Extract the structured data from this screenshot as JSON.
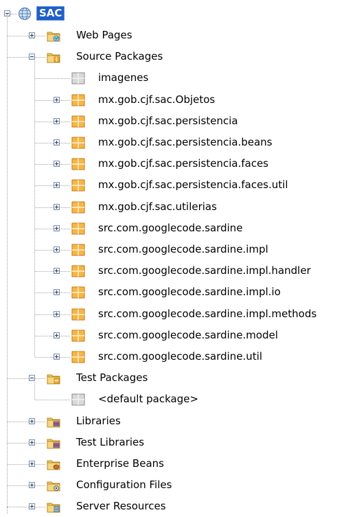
{
  "tree": {
    "root": {
      "label": "SAC",
      "icon": "globe-project-icon"
    },
    "nodes": [
      {
        "label": "Web Pages",
        "icon": "web-folder-icon",
        "level": 1,
        "toggle": "plus"
      },
      {
        "label": "Source Packages",
        "icon": "source-folder-icon",
        "level": 1,
        "toggle": "minus"
      },
      {
        "label": "imagenes",
        "icon": "empty-package-icon",
        "level": 2,
        "toggle": "none"
      },
      {
        "label": "mx.gob.cjf.sac.Objetos",
        "icon": "package-icon",
        "level": 2,
        "toggle": "plus"
      },
      {
        "label": "mx.gob.cjf.sac.persistencia",
        "icon": "package-icon",
        "level": 2,
        "toggle": "plus"
      },
      {
        "label": "mx.gob.cjf.sac.persistencia.beans",
        "icon": "package-icon",
        "level": 2,
        "toggle": "plus"
      },
      {
        "label": "mx.gob.cjf.sac.persistencia.faces",
        "icon": "package-icon",
        "level": 2,
        "toggle": "plus"
      },
      {
        "label": "mx.gob.cjf.sac.persistencia.faces.util",
        "icon": "package-icon",
        "level": 2,
        "toggle": "plus"
      },
      {
        "label": "mx.gob.cjf.sac.utilerias",
        "icon": "package-icon",
        "level": 2,
        "toggle": "plus"
      },
      {
        "label": "src.com.googlecode.sardine",
        "icon": "package-icon",
        "level": 2,
        "toggle": "plus"
      },
      {
        "label": "src.com.googlecode.sardine.impl",
        "icon": "package-icon",
        "level": 2,
        "toggle": "plus"
      },
      {
        "label": "src.com.googlecode.sardine.impl.handler",
        "icon": "package-icon",
        "level": 2,
        "toggle": "plus"
      },
      {
        "label": "src.com.googlecode.sardine.impl.io",
        "icon": "package-icon",
        "level": 2,
        "toggle": "plus"
      },
      {
        "label": "src.com.googlecode.sardine.impl.methods",
        "icon": "package-icon",
        "level": 2,
        "toggle": "plus"
      },
      {
        "label": "src.com.googlecode.sardine.model",
        "icon": "package-icon",
        "level": 2,
        "toggle": "plus"
      },
      {
        "label": "src.com.googlecode.sardine.util",
        "icon": "package-icon",
        "level": 2,
        "toggle": "plus"
      },
      {
        "label": "Test Packages",
        "icon": "test-folder-icon",
        "level": 1,
        "toggle": "minus"
      },
      {
        "label": "<default package>",
        "icon": "empty-package-icon",
        "level": 2,
        "toggle": "none"
      },
      {
        "label": "Libraries",
        "icon": "library-folder-icon",
        "level": 1,
        "toggle": "plus"
      },
      {
        "label": "Test Libraries",
        "icon": "library-folder-icon",
        "level": 1,
        "toggle": "plus"
      },
      {
        "label": "Enterprise Beans",
        "icon": "beans-folder-icon",
        "level": 1,
        "toggle": "plus"
      },
      {
        "label": "Configuration Files",
        "icon": "config-folder-icon",
        "level": 1,
        "toggle": "plus"
      },
      {
        "label": "Server Resources",
        "icon": "server-folder-icon",
        "level": 1,
        "toggle": "plus"
      }
    ]
  },
  "colors": {
    "selection": "#1f5fc6",
    "package_orange": "#f0a030",
    "folder_yellow": "#f1c862",
    "tree_line": "#a0a0a0"
  }
}
